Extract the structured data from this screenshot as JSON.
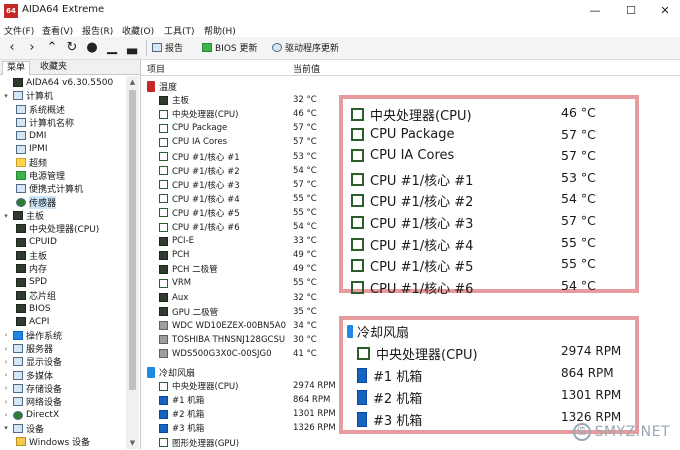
{
  "window": {
    "logo_text": "64",
    "title": "AIDA64 Extreme",
    "minimize": "—",
    "maximize": "☐",
    "close": "✕"
  },
  "menu": [
    "文件(F)",
    "查看(V)",
    "报告(R)",
    "收藏(O)",
    "工具(T)",
    "帮助(H)"
  ],
  "toolbar": {
    "report_label": "报告",
    "bios_update_label": "BIOS 更新",
    "driver_update_label": "驱动程序更新"
  },
  "left_tabs": [
    "菜单",
    "收藏夹"
  ],
  "tree": [
    {
      "label": "AIDA64 v6.30.5500",
      "level": 0,
      "icon": "aida-logo-icon",
      "expander": ""
    },
    {
      "label": "计算机",
      "level": 0,
      "icon": "computer-icon",
      "expander": "▾"
    },
    {
      "label": "系统概述",
      "level": 1,
      "icon": "summary-icon",
      "expander": ""
    },
    {
      "label": "计算机名称",
      "level": 1,
      "icon": "computer-name-icon",
      "expander": ""
    },
    {
      "label": "DMI",
      "level": 1,
      "icon": "dmi-icon",
      "expander": ""
    },
    {
      "label": "IPMI",
      "level": 1,
      "icon": "ipmi-icon",
      "expander": ""
    },
    {
      "label": "超频",
      "level": 1,
      "icon": "overclock-icon",
      "expander": ""
    },
    {
      "label": "电源管理",
      "level": 1,
      "icon": "power-icon",
      "expander": ""
    },
    {
      "label": "便携式计算机",
      "level": 1,
      "icon": "laptop-icon",
      "expander": ""
    },
    {
      "label": "传感器",
      "level": 1,
      "icon": "sensor-icon",
      "expander": "",
      "selected": true
    },
    {
      "label": "主板",
      "level": 0,
      "icon": "motherboard-icon",
      "expander": "▾"
    },
    {
      "label": "中央处理器(CPU)",
      "level": 1,
      "icon": "cpu-icon",
      "expander": ""
    },
    {
      "label": "CPUID",
      "level": 1,
      "icon": "cpuid-icon",
      "expander": ""
    },
    {
      "label": "主板",
      "level": 1,
      "icon": "motherboard-icon",
      "expander": ""
    },
    {
      "label": "内存",
      "level": 1,
      "icon": "memory-icon",
      "expander": ""
    },
    {
      "label": "SPD",
      "level": 1,
      "icon": "spd-icon",
      "expander": ""
    },
    {
      "label": "芯片组",
      "level": 1,
      "icon": "chipset-icon",
      "expander": ""
    },
    {
      "label": "BIOS",
      "level": 1,
      "icon": "bios-icon",
      "expander": ""
    },
    {
      "label": "ACPI",
      "level": 1,
      "icon": "acpi-icon",
      "expander": ""
    },
    {
      "label": "操作系统",
      "level": 0,
      "icon": "windows-icon",
      "expander": "›"
    },
    {
      "label": "服务器",
      "level": 0,
      "icon": "server-icon",
      "expander": "›"
    },
    {
      "label": "显示设备",
      "level": 0,
      "icon": "display-icon",
      "expander": "›"
    },
    {
      "label": "多媒体",
      "level": 0,
      "icon": "multimedia-icon",
      "expander": "›"
    },
    {
      "label": "存储设备",
      "level": 0,
      "icon": "storage-icon",
      "expander": "›"
    },
    {
      "label": "网络设备",
      "level": 0,
      "icon": "network-icon",
      "expander": "›"
    },
    {
      "label": "DirectX",
      "level": 0,
      "icon": "directx-icon",
      "expander": "›"
    },
    {
      "label": "设备",
      "level": 0,
      "icon": "devices-icon",
      "expander": "▾"
    },
    {
      "label": "Windows 设备",
      "level": 1,
      "icon": "windows-devices-icon",
      "expander": ""
    }
  ],
  "columns": {
    "item": "项目",
    "value": "当前值"
  },
  "temperature": {
    "category": "温度",
    "rows": [
      {
        "label": "主板",
        "value": "32 °C",
        "icon": "motherboard"
      },
      {
        "label": "中央处理器(CPU)",
        "value": "46 °C",
        "icon": "sensor"
      },
      {
        "label": "CPU Package",
        "value": "57 °C",
        "icon": "sensor"
      },
      {
        "label": "CPU IA Cores",
        "value": "57 °C",
        "icon": "sensor"
      },
      {
        "label": "CPU #1/核心 #1",
        "value": "53 °C",
        "icon": "sensor"
      },
      {
        "label": "CPU #1/核心 #2",
        "value": "54 °C",
        "icon": "sensor"
      },
      {
        "label": "CPU #1/核心 #3",
        "value": "57 °C",
        "icon": "sensor"
      },
      {
        "label": "CPU #1/核心 #4",
        "value": "55 °C",
        "icon": "sensor"
      },
      {
        "label": "CPU #1/核心 #5",
        "value": "55 °C",
        "icon": "sensor"
      },
      {
        "label": "CPU #1/核心 #6",
        "value": "54 °C",
        "icon": "sensor"
      },
      {
        "label": "PCI-E",
        "value": "33 °C",
        "icon": "pcie"
      },
      {
        "label": "PCH",
        "value": "49 °C",
        "icon": "chip"
      },
      {
        "label": "PCH 二极管",
        "value": "49 °C",
        "icon": "chip"
      },
      {
        "label": "VRM",
        "value": "55 °C",
        "icon": "vrm"
      },
      {
        "label": "Aux",
        "value": "32 °C",
        "icon": "aux"
      },
      {
        "label": "GPU 二极管",
        "value": "35 °C",
        "icon": "gpu"
      },
      {
        "label": "WDC WD10EZEX-00BN5A0",
        "value": "34 °C",
        "icon": "disk"
      },
      {
        "label": "TOSHIBA THNSNJ128GCSU",
        "value": "30 °C",
        "icon": "disk"
      },
      {
        "label": "WDS500G3X0C-00SJG0",
        "value": "41 °C",
        "icon": "disk"
      }
    ]
  },
  "cooling": {
    "category": "冷却风扇",
    "rows": [
      {
        "label": "中央处理器(CPU)",
        "value": "2974 RPM",
        "icon": "sensor"
      },
      {
        "label": "#1 机箱",
        "value": "864 RPM",
        "icon": "fan"
      },
      {
        "label": "#2 机箱",
        "value": "1301 RPM",
        "icon": "fan"
      },
      {
        "label": "#3 机箱",
        "value": "1326 RPM",
        "icon": "fan"
      },
      {
        "label": "图形处理器(GPU)",
        "value": "",
        "icon": "sensor"
      }
    ]
  },
  "zoom_temperature": [
    {
      "label": "中央处理器(CPU)",
      "value": "46 °C"
    },
    {
      "label": "CPU Package",
      "value": "57 °C"
    },
    {
      "label": "CPU IA Cores",
      "value": "57 °C"
    },
    {
      "label": "CPU #1/核心 #1",
      "value": "53 °C"
    },
    {
      "label": "CPU #1/核心 #2",
      "value": "54 °C"
    },
    {
      "label": "CPU #1/核心 #3",
      "value": "57 °C"
    },
    {
      "label": "CPU #1/核心 #4",
      "value": "55 °C"
    },
    {
      "label": "CPU #1/核心 #5",
      "value": "55 °C"
    },
    {
      "label": "CPU #1/核心 #6",
      "value": "54 °C"
    }
  ],
  "zoom_cooling": {
    "category": "冷却风扇",
    "rows": [
      {
        "label": "中央处理器(CPU)",
        "value": "2974 RPM",
        "icon": "sensor"
      },
      {
        "label": "#1 机箱",
        "value": "864 RPM",
        "icon": "fan"
      },
      {
        "label": "#2 机箱",
        "value": "1301 RPM",
        "icon": "fan"
      },
      {
        "label": "#3 机箱",
        "value": "1326 RPM",
        "icon": "fan"
      }
    ]
  },
  "watermark": {
    "logo": "值",
    "text": "SMYZ.NET"
  },
  "colors": {
    "highlight_border": "#e79b9f",
    "selected_bg": "#cce4f7"
  }
}
